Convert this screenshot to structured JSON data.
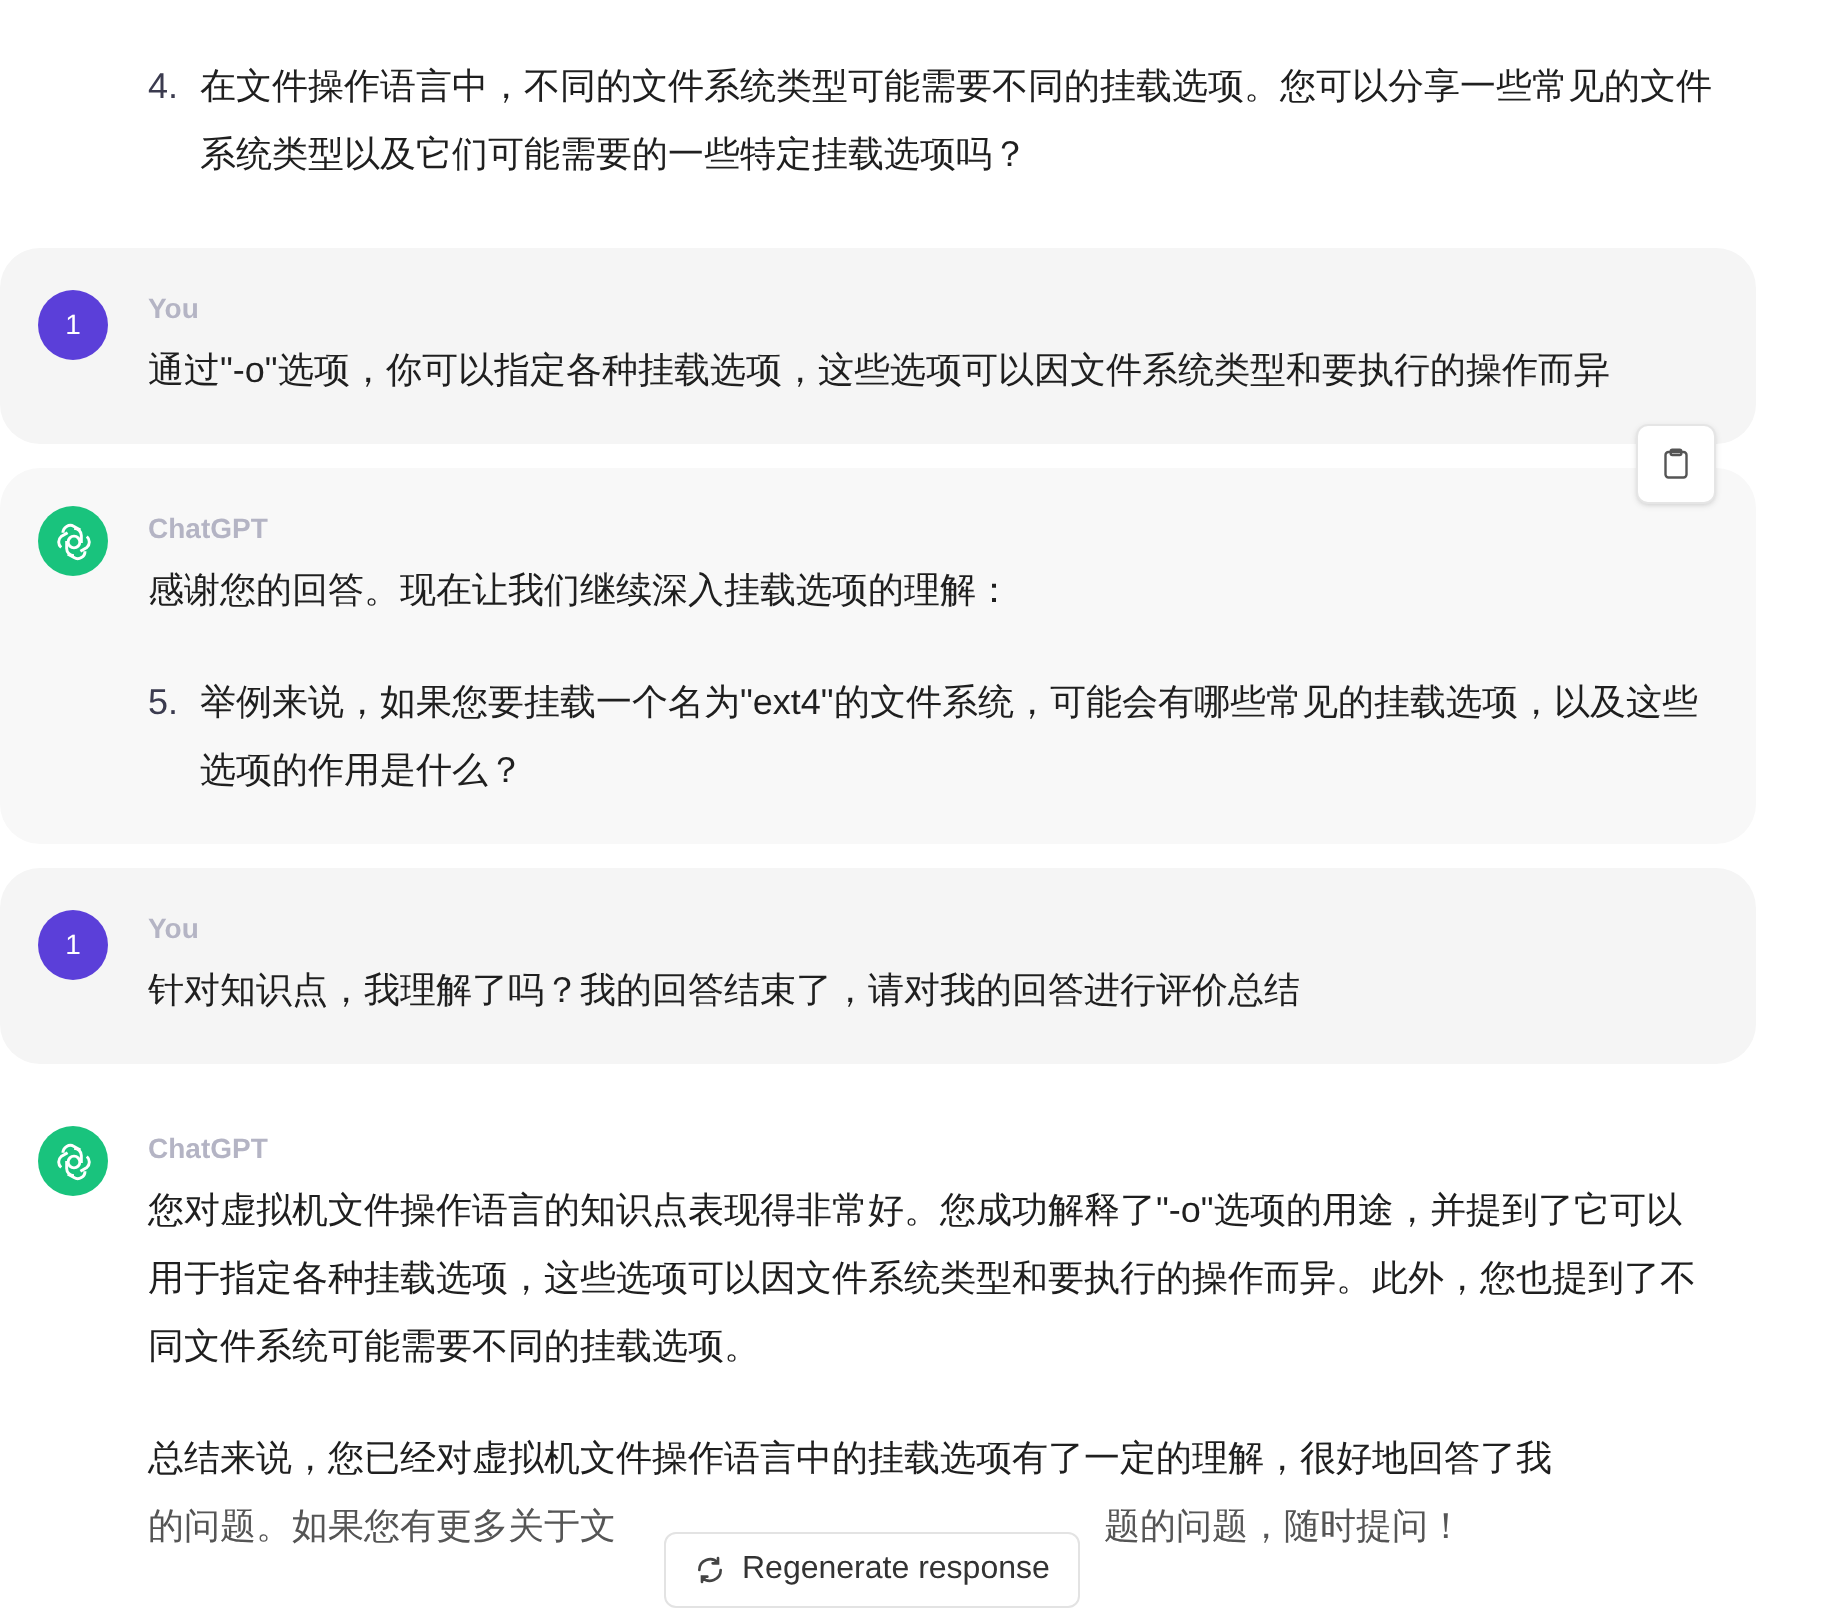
{
  "top_list_item": {
    "number": "4.",
    "text": "在文件操作语言中，不同的文件系统类型可能需要不同的挂载选项。您可以分享一些常见的文件系统类型以及它们可能需要的一些特定挂载选项吗？"
  },
  "messages": [
    {
      "kind": "user",
      "author": "You",
      "avatar": "1",
      "hovered": false,
      "blocks": [
        {
          "kind": "paragraph",
          "text": "通过\"-o\"选项，你可以指定各种挂载选项，这些选项可以因文件系统类型和要执行的操作而异"
        }
      ]
    },
    {
      "kind": "assistant",
      "author": "ChatGPT",
      "hovered": true,
      "blocks": [
        {
          "kind": "paragraph",
          "text": "感谢您的回答。现在让我们继续深入挂载选项的理解："
        },
        {
          "kind": "list_item",
          "number": "5.",
          "text": "举例来说，如果您要挂载一个名为\"ext4\"的文件系统，可能会有哪些常见的挂载选项，以及这些选项的作用是什么？"
        }
      ]
    },
    {
      "kind": "user",
      "author": "You",
      "avatar": "1",
      "hovered": false,
      "blocks": [
        {
          "kind": "paragraph",
          "text": "针对知识点，我理解了吗？我的回答结束了，请对我的回答进行评价总结"
        }
      ]
    },
    {
      "kind": "assistant",
      "author": "ChatGPT",
      "hovered": false,
      "blocks": [
        {
          "kind": "paragraph",
          "text": "您对虚拟机文件操作语言的知识点表现得非常好。您成功解释了\"-o\"选项的用途，并提到了它可以用于指定各种挂载选项，这些选项可以因文件系统类型和要执行的操作而异。此外，您也提到了不同文件系统可能需要不同的挂载选项。"
        },
        {
          "kind": "covered_paragraph",
          "line": "总结来说，您已经对虚拟机文件操作语言中的挂载选项有了一定的理解，很好地回答了我",
          "before": "的问题。如果您有更多关于文",
          "after": "题的问题，随时提问！"
        }
      ]
    }
  ],
  "regenerate_button": {
    "label": "Regenerate response"
  }
}
